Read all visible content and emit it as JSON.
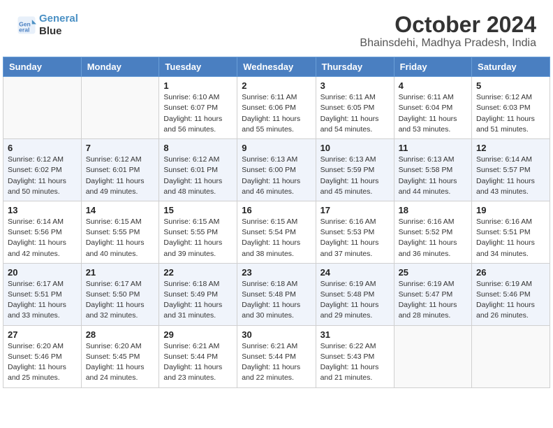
{
  "header": {
    "logo_line1": "General",
    "logo_line2": "Blue",
    "title": "October 2024",
    "subtitle": "Bhainsdehi, Madhya Pradesh, India"
  },
  "days_of_week": [
    "Sunday",
    "Monday",
    "Tuesday",
    "Wednesday",
    "Thursday",
    "Friday",
    "Saturday"
  ],
  "weeks": [
    [
      {
        "day": "",
        "info": ""
      },
      {
        "day": "",
        "info": ""
      },
      {
        "day": "1",
        "info": "Sunrise: 6:10 AM\nSunset: 6:07 PM\nDaylight: 11 hours\nand 56 minutes."
      },
      {
        "day": "2",
        "info": "Sunrise: 6:11 AM\nSunset: 6:06 PM\nDaylight: 11 hours\nand 55 minutes."
      },
      {
        "day": "3",
        "info": "Sunrise: 6:11 AM\nSunset: 6:05 PM\nDaylight: 11 hours\nand 54 minutes."
      },
      {
        "day": "4",
        "info": "Sunrise: 6:11 AM\nSunset: 6:04 PM\nDaylight: 11 hours\nand 53 minutes."
      },
      {
        "day": "5",
        "info": "Sunrise: 6:12 AM\nSunset: 6:03 PM\nDaylight: 11 hours\nand 51 minutes."
      }
    ],
    [
      {
        "day": "6",
        "info": "Sunrise: 6:12 AM\nSunset: 6:02 PM\nDaylight: 11 hours\nand 50 minutes."
      },
      {
        "day": "7",
        "info": "Sunrise: 6:12 AM\nSunset: 6:01 PM\nDaylight: 11 hours\nand 49 minutes."
      },
      {
        "day": "8",
        "info": "Sunrise: 6:12 AM\nSunset: 6:01 PM\nDaylight: 11 hours\nand 48 minutes."
      },
      {
        "day": "9",
        "info": "Sunrise: 6:13 AM\nSunset: 6:00 PM\nDaylight: 11 hours\nand 46 minutes."
      },
      {
        "day": "10",
        "info": "Sunrise: 6:13 AM\nSunset: 5:59 PM\nDaylight: 11 hours\nand 45 minutes."
      },
      {
        "day": "11",
        "info": "Sunrise: 6:13 AM\nSunset: 5:58 PM\nDaylight: 11 hours\nand 44 minutes."
      },
      {
        "day": "12",
        "info": "Sunrise: 6:14 AM\nSunset: 5:57 PM\nDaylight: 11 hours\nand 43 minutes."
      }
    ],
    [
      {
        "day": "13",
        "info": "Sunrise: 6:14 AM\nSunset: 5:56 PM\nDaylight: 11 hours\nand 42 minutes."
      },
      {
        "day": "14",
        "info": "Sunrise: 6:15 AM\nSunset: 5:55 PM\nDaylight: 11 hours\nand 40 minutes."
      },
      {
        "day": "15",
        "info": "Sunrise: 6:15 AM\nSunset: 5:55 PM\nDaylight: 11 hours\nand 39 minutes."
      },
      {
        "day": "16",
        "info": "Sunrise: 6:15 AM\nSunset: 5:54 PM\nDaylight: 11 hours\nand 38 minutes."
      },
      {
        "day": "17",
        "info": "Sunrise: 6:16 AM\nSunset: 5:53 PM\nDaylight: 11 hours\nand 37 minutes."
      },
      {
        "day": "18",
        "info": "Sunrise: 6:16 AM\nSunset: 5:52 PM\nDaylight: 11 hours\nand 36 minutes."
      },
      {
        "day": "19",
        "info": "Sunrise: 6:16 AM\nSunset: 5:51 PM\nDaylight: 11 hours\nand 34 minutes."
      }
    ],
    [
      {
        "day": "20",
        "info": "Sunrise: 6:17 AM\nSunset: 5:51 PM\nDaylight: 11 hours\nand 33 minutes."
      },
      {
        "day": "21",
        "info": "Sunrise: 6:17 AM\nSunset: 5:50 PM\nDaylight: 11 hours\nand 32 minutes."
      },
      {
        "day": "22",
        "info": "Sunrise: 6:18 AM\nSunset: 5:49 PM\nDaylight: 11 hours\nand 31 minutes."
      },
      {
        "day": "23",
        "info": "Sunrise: 6:18 AM\nSunset: 5:48 PM\nDaylight: 11 hours\nand 30 minutes."
      },
      {
        "day": "24",
        "info": "Sunrise: 6:19 AM\nSunset: 5:48 PM\nDaylight: 11 hours\nand 29 minutes."
      },
      {
        "day": "25",
        "info": "Sunrise: 6:19 AM\nSunset: 5:47 PM\nDaylight: 11 hours\nand 28 minutes."
      },
      {
        "day": "26",
        "info": "Sunrise: 6:19 AM\nSunset: 5:46 PM\nDaylight: 11 hours\nand 26 minutes."
      }
    ],
    [
      {
        "day": "27",
        "info": "Sunrise: 6:20 AM\nSunset: 5:46 PM\nDaylight: 11 hours\nand 25 minutes."
      },
      {
        "day": "28",
        "info": "Sunrise: 6:20 AM\nSunset: 5:45 PM\nDaylight: 11 hours\nand 24 minutes."
      },
      {
        "day": "29",
        "info": "Sunrise: 6:21 AM\nSunset: 5:44 PM\nDaylight: 11 hours\nand 23 minutes."
      },
      {
        "day": "30",
        "info": "Sunrise: 6:21 AM\nSunset: 5:44 PM\nDaylight: 11 hours\nand 22 minutes."
      },
      {
        "day": "31",
        "info": "Sunrise: 6:22 AM\nSunset: 5:43 PM\nDaylight: 11 hours\nand 21 minutes."
      },
      {
        "day": "",
        "info": ""
      },
      {
        "day": "",
        "info": ""
      }
    ]
  ]
}
